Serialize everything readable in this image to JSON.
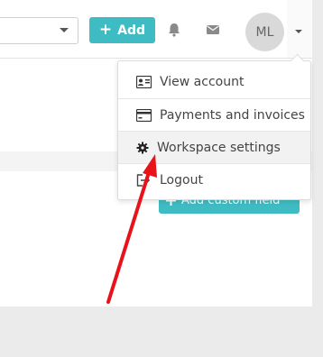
{
  "toolbar": {
    "add_label": "Add",
    "add_icon": "plus-icon",
    "avatar_initials": "ML"
  },
  "main": {
    "custom_field_button_label": "Add custom field"
  },
  "user_menu": {
    "items": [
      {
        "label": "View account",
        "icon": "id-card-icon"
      },
      {
        "label": "Payments and invoices",
        "icon": "credit-card-icon"
      },
      {
        "label": "Workspace settings",
        "icon": "gear-icon"
      },
      {
        "label": "Logout",
        "icon": "sign-out-icon"
      }
    ]
  },
  "colors": {
    "accent": "#3fbcc3",
    "annotation_arrow": "#e8121b",
    "hover_bg": "#f2f2f2"
  }
}
